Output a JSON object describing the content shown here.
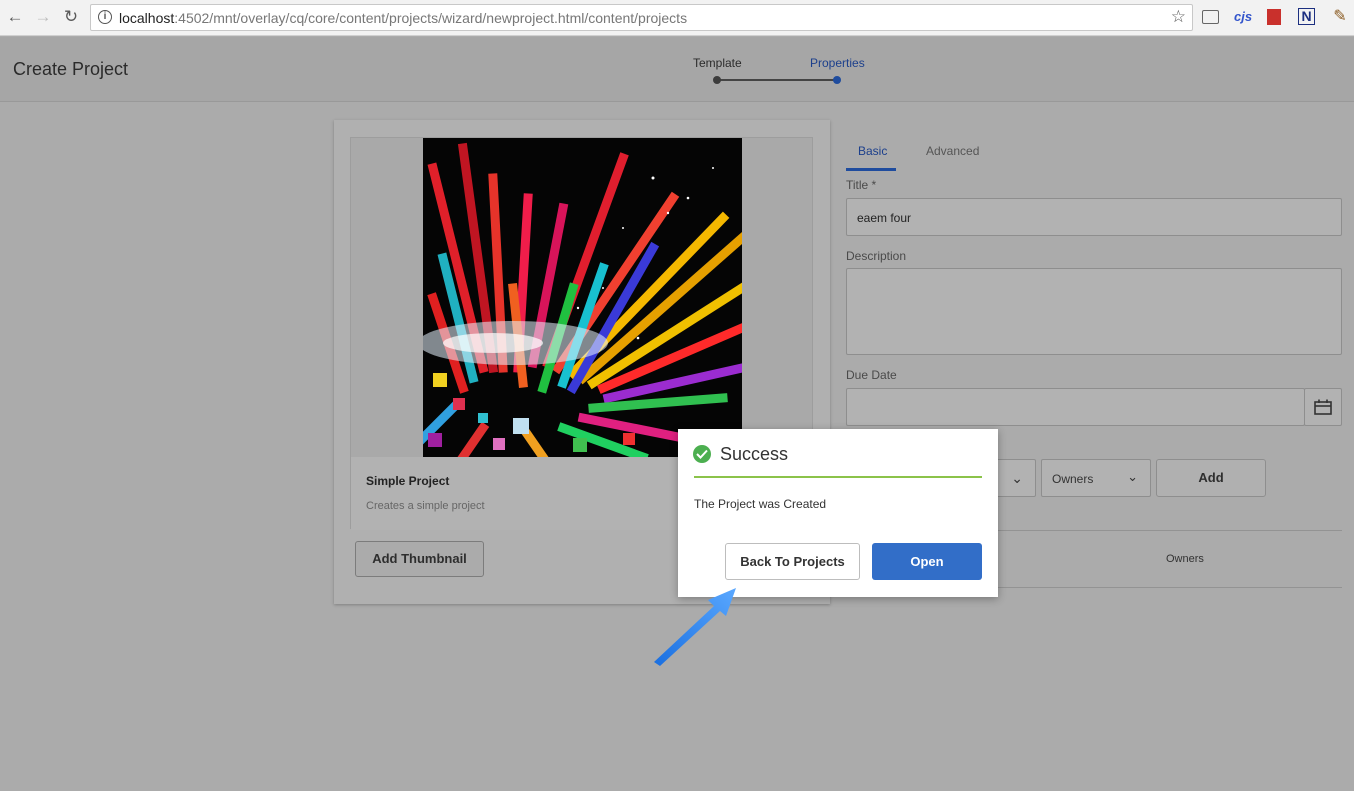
{
  "browser": {
    "url_host": "localhost",
    "url_rest": ":4502/mnt/overlay/cq/core/content/projects/wizard/newproject.html/content/projects",
    "ext_cjs": "cjs",
    "ext_n": "N"
  },
  "header": {
    "title": "Create Project",
    "steps": [
      {
        "label": "Template",
        "state": "done"
      },
      {
        "label": "Properties",
        "state": "active"
      }
    ]
  },
  "template_card": {
    "title": "Simple Project",
    "description": "Creates a simple project",
    "add_thumbnail_label": "Add Thumbnail"
  },
  "form": {
    "tabs": [
      {
        "label": "Basic",
        "active": true
      },
      {
        "label": "Advanced",
        "active": false
      }
    ],
    "title_label": "Title *",
    "title_value": "eaem four",
    "description_label": "Description",
    "description_value": "",
    "due_date_label": "Due Date",
    "due_date_value": "",
    "role_select_value": "Owners",
    "add_label": "Add",
    "members_column_role": "Owners"
  },
  "dialog": {
    "title": "Success",
    "message": "The Project was Created",
    "back_label": "Back To Projects",
    "open_label": "Open"
  },
  "colors": {
    "accent": "#326ec8",
    "success": "#4caf50",
    "success_rule": "#8bc34a",
    "annotation_arrow": "#3a8df0"
  }
}
